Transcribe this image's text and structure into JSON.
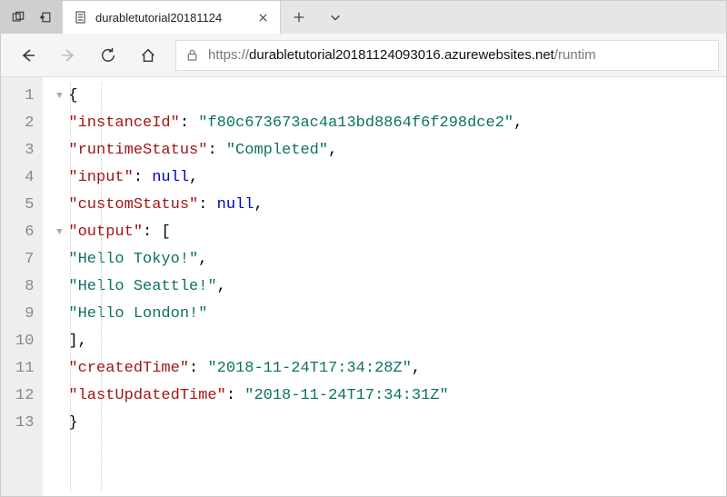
{
  "titlebar": {
    "tab_title": "durabletutorial20181124"
  },
  "url": {
    "scheme": "https://",
    "host": "durabletutorial20181124093016.azurewebsites.net",
    "path": "/runtim"
  },
  "json": {
    "k_instanceId": "instanceId",
    "v_instanceId": "f80c673673ac4a13bd8864f6f298dce2",
    "k_runtimeStatus": "runtimeStatus",
    "v_runtimeStatus": "Completed",
    "k_input": "input",
    "v_input": "null",
    "k_customStatus": "customStatus",
    "v_customStatus": "null",
    "k_output": "output",
    "output_0": "Hello Tokyo!",
    "output_1": "Hello Seattle!",
    "output_2": "Hello London!",
    "k_createdTime": "createdTime",
    "v_createdTime": "2018-11-24T17:34:28Z",
    "k_lastUpdatedTime": "lastUpdatedTime",
    "v_lastUpdatedTime": "2018-11-24T17:34:31Z"
  },
  "lines": {
    "l1": "1",
    "l2": "2",
    "l3": "3",
    "l4": "4",
    "l5": "5",
    "l6": "6",
    "l7": "7",
    "l8": "8",
    "l9": "9",
    "l10": "10",
    "l11": "11",
    "l12": "12",
    "l13": "13"
  }
}
